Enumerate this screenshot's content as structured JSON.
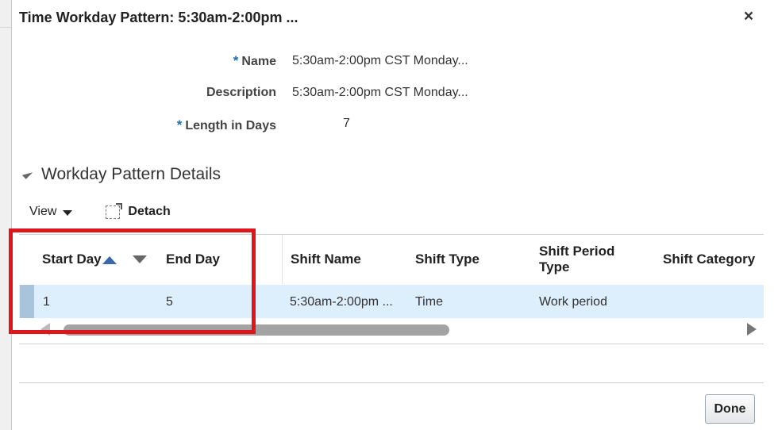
{
  "dialog": {
    "title": "Time Workday Pattern: 5:30am-2:00pm ...",
    "close_glyph": "×",
    "done_label": "Done"
  },
  "form": {
    "required_marker": "*",
    "name_label": "Name",
    "name_value": "5:30am-2:00pm CST Monday...",
    "description_label": "Description",
    "description_value": "5:30am-2:00pm CST Monday...",
    "length_label": "Length in Days",
    "length_value": "7"
  },
  "section": {
    "title": "Workday Pattern Details",
    "icon": "collapse-triangle-icon"
  },
  "toolbar": {
    "view_label": "View",
    "detach_label": "Detach",
    "detach_icon": "detach-icon"
  },
  "table": {
    "columns": [
      "Start Day",
      "End Day",
      "Shift Name",
      "Shift Type",
      "Shift Period Type",
      "Shift Category"
    ],
    "rows": [
      [
        "1",
        "5",
        "5:30am-2:00pm ...",
        "Time",
        "Work period",
        ""
      ]
    ],
    "sort": {
      "column": "Start Day",
      "direction": "ascending"
    }
  },
  "colors": {
    "accent": "#1a6fb5",
    "selected_row": "#ddeefc",
    "highlight_box": "#e0141b"
  }
}
